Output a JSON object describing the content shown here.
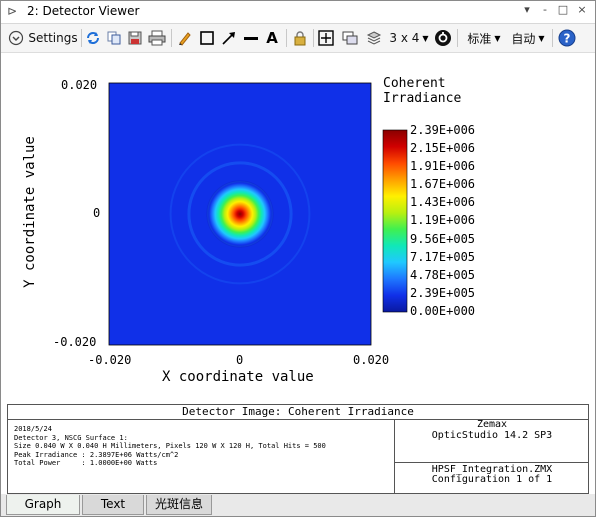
{
  "window": {
    "title": "2: Detector Viewer",
    "controls": [
      "▾",
      "-",
      "□",
      "×"
    ]
  },
  "toolbar": {
    "settings_label": "Settings",
    "layout_label": "3 x 4",
    "std_label": "标准",
    "auto_label": "自动",
    "icons": [
      "refresh-icon",
      "copy-icon",
      "save-icon",
      "print-icon",
      "pencil-icon",
      "rectangle-icon",
      "arrow-icon",
      "line-icon",
      "text-icon",
      "lock-icon",
      "zoom-icon",
      "window-icon",
      "layers-icon",
      "settings-gear-icon",
      "help-icon"
    ]
  },
  "colors": {
    "accent": "#1e5bd8",
    "background": "#ffffff"
  },
  "chart_data": {
    "type": "heatmap",
    "title": "",
    "xlabel": "X coordinate value",
    "ylabel": "Y coordinate value",
    "xlim": [
      -0.02,
      0.02
    ],
    "ylim": [
      -0.02,
      0.02
    ],
    "x_ticks": [
      "-0.020",
      "0",
      "0.020"
    ],
    "y_ticks": [
      "0.020",
      "0",
      "-0.020"
    ],
    "colorbar_title": [
      "Coherent",
      "Irradiance"
    ],
    "colorbar_ticks": [
      "2.39E+006",
      "2.15E+006",
      "1.91E+006",
      "1.67E+006",
      "1.43E+006",
      "1.19E+006",
      "9.56E+005",
      "7.17E+005",
      "4.78E+005",
      "2.39E+005",
      "0.00E+000"
    ],
    "colorbar_stops": [
      "#0a19a0",
      "#1030e8",
      "#1e78ff",
      "#20c8ff",
      "#10e8b8",
      "#40f050",
      "#b8f010",
      "#fff000",
      "#ffa000",
      "#ff4a00",
      "#d00000",
      "#8a0000"
    ],
    "beam": {
      "center_x": 0.0,
      "center_y": 0.0,
      "peak": 2389700,
      "rings": [
        0.0047,
        0.0078,
        0.0106
      ]
    }
  },
  "info": {
    "title": "Detector Image: Coherent Irradiance",
    "details": [
      "2018/5/24",
      "Detector 3, NSCG Surface 1:",
      "Size 0.040 W X 0.040 H Millimeters, Pixels 120 W X 120 H, Total Hits = 500",
      "Peak Irradiance : 2.3897E+06 Watts/cm^2",
      "Total Power     : 1.0000E+00 Watts"
    ],
    "vendor": "Zemax",
    "product": "OpticStudio 14.2 SP3",
    "file": "HPSF_Integration.ZMX",
    "configuration": "Configuration 1 of 1"
  },
  "tabs": [
    "Graph",
    "Text",
    "光斑信息"
  ]
}
